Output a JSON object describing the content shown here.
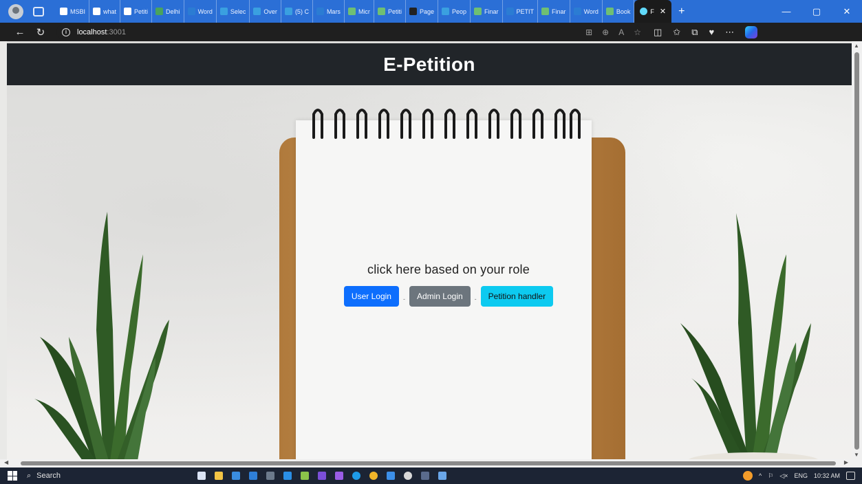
{
  "browser": {
    "tabs": [
      {
        "label": "MSBI",
        "color": "#ffffff"
      },
      {
        "label": "what",
        "color": "#ffffff"
      },
      {
        "label": "Petiti",
        "color": "#ffffff"
      },
      {
        "label": "Delhi",
        "color": "#4aa35c"
      },
      {
        "label": "Word",
        "color": "#2b7cd3"
      },
      {
        "label": "Selec",
        "color": "#3aa0e0"
      },
      {
        "label": "Over",
        "color": "#3aa0e0"
      },
      {
        "label": "(5) C",
        "color": "#3aa0e0"
      },
      {
        "label": "Mars",
        "color": "#2b7cd3"
      },
      {
        "label": "Micr",
        "color": "#6fbf73"
      },
      {
        "label": "Petiti",
        "color": "#6fbf73"
      },
      {
        "label": "Page",
        "color": "#222222"
      },
      {
        "label": "Peop",
        "color": "#3aa0e0"
      },
      {
        "label": "Finar",
        "color": "#6fbf73"
      },
      {
        "label": "PETIT",
        "color": "#2b7cd3"
      },
      {
        "label": "Finar",
        "color": "#6fbf73"
      },
      {
        "label": "Word",
        "color": "#2b7cd3"
      },
      {
        "label": "Book",
        "color": "#6fbf73"
      }
    ],
    "active_tab": {
      "label": "F",
      "close": "✕"
    },
    "new_tab": "+",
    "window_controls": {
      "minimize": "—",
      "restore": "▢",
      "close": "✕"
    },
    "url_host": "localhost",
    "url_port": ":3001"
  },
  "page": {
    "title": "E-Petition",
    "heading": "click here based on your role",
    "buttons": {
      "user": "User Login",
      "admin": "Admin Login",
      "handler": "Petition handler"
    },
    "separator": "-"
  },
  "taskbar": {
    "search_label": "Search",
    "language": "ENG",
    "time": "10:32 AM"
  }
}
